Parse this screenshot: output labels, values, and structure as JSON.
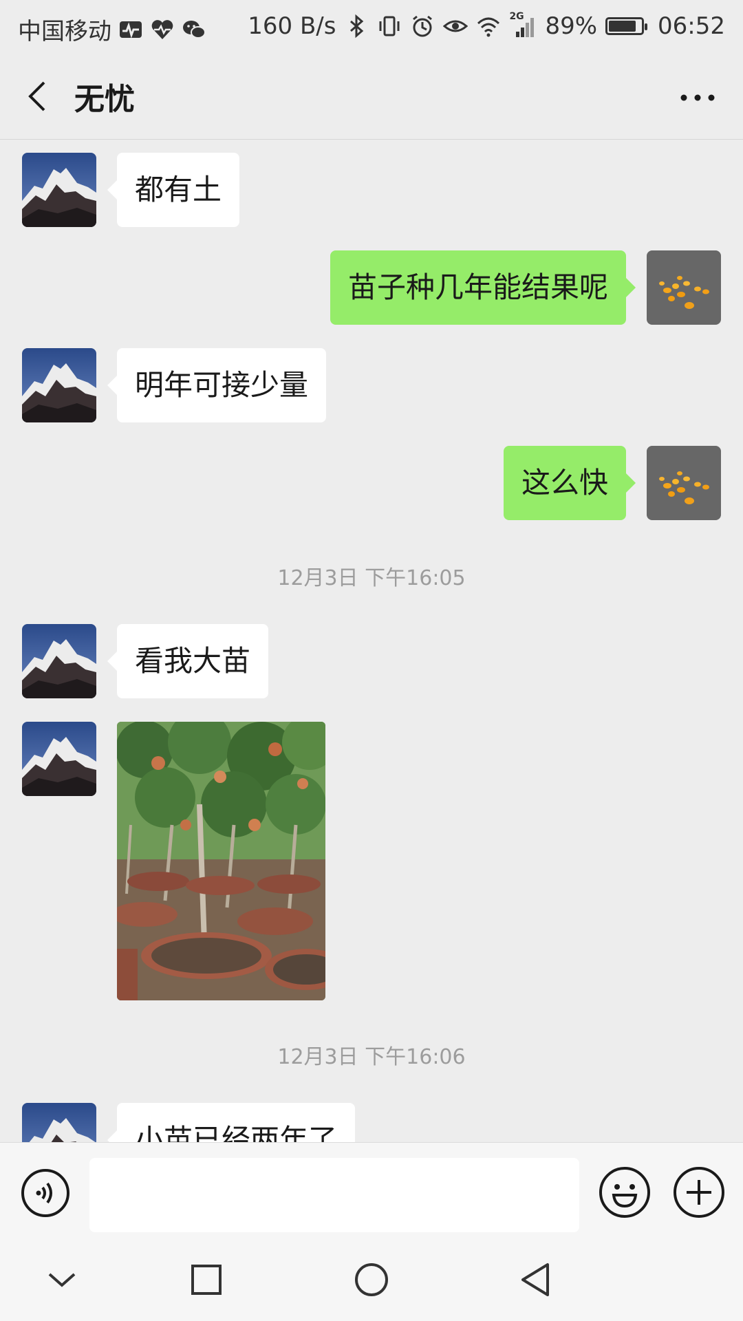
{
  "status_bar": {
    "carrier": "中国移动",
    "net_speed": "160 B/s",
    "network_type": "2G",
    "battery": "89%",
    "battery_level": 0.89,
    "time": "06:52"
  },
  "header": {
    "title": "无忧"
  },
  "messages": [
    {
      "side": "left",
      "text": "都有土"
    },
    {
      "side": "right",
      "text": "苗子种几年能结果呢"
    },
    {
      "side": "left",
      "text": "明年可接少量"
    },
    {
      "side": "right",
      "text": "这么快"
    },
    {
      "timestamp": "12月3日 下午16:05"
    },
    {
      "side": "left",
      "text": "看我大苗"
    },
    {
      "side": "left",
      "image": "potted-trees-photo"
    },
    {
      "timestamp": "12月3日 下午16:06"
    },
    {
      "side": "left",
      "text": "小苗已经两年了"
    }
  ],
  "input": {
    "value": "",
    "placeholder": ""
  },
  "colors": {
    "background": "#ededed",
    "sent_bubble": "#95ec69",
    "received_bubble": "#ffffff",
    "timestamp": "#9c9c9c"
  },
  "icons": {
    "back": "chevron-left-icon",
    "more": "more-dots-icon",
    "voice": "voice-icon",
    "emoji": "emoji-icon",
    "plus": "plus-icon",
    "nav_down": "nav-down-icon",
    "nav_recent": "nav-recent-icon",
    "nav_home": "nav-home-icon",
    "nav_back": "nav-back-icon"
  }
}
